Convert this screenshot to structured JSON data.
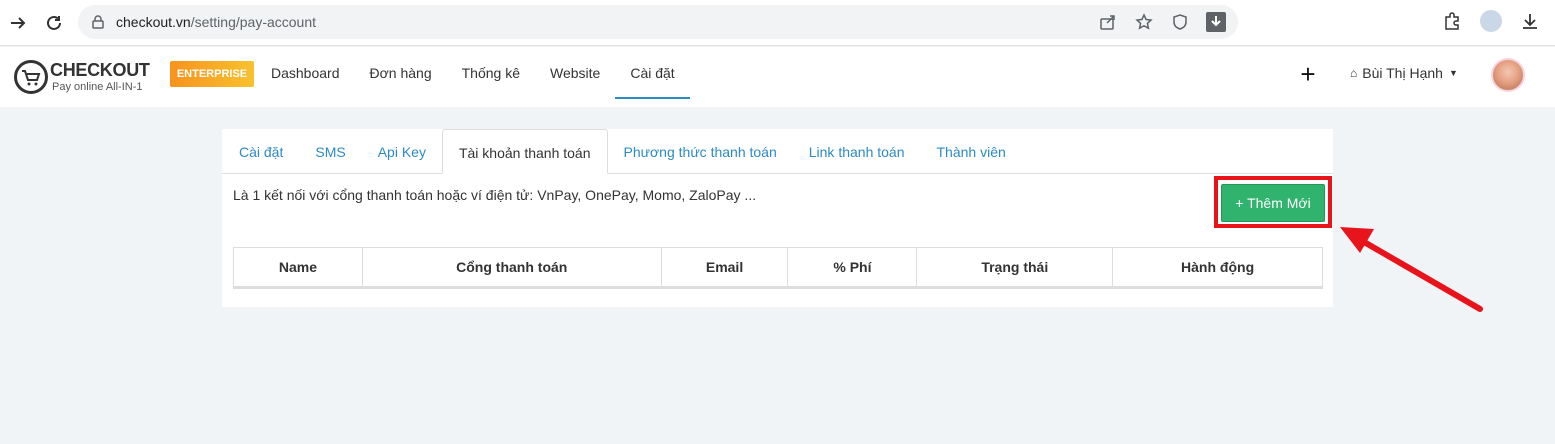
{
  "browser": {
    "url_host": "checkout.vn",
    "url_path": "/setting/pay-account"
  },
  "header": {
    "logo_title": "CHECKOUT",
    "logo_subtitle": "Pay online All-IN-1",
    "badge": "ENTERPRISE",
    "nav": [
      {
        "label": "Dashboard"
      },
      {
        "label": "Đơn hàng"
      },
      {
        "label": "Thống kê"
      },
      {
        "label": "Website"
      },
      {
        "label": "Cài đặt"
      }
    ],
    "user_name": "Bùi Thị Hạnh"
  },
  "tabs": [
    {
      "label": "Cài đặt"
    },
    {
      "label": "SMS"
    },
    {
      "label": "Api Key"
    },
    {
      "label": "Tài khoản thanh toán"
    },
    {
      "label": "Phương thức thanh toán"
    },
    {
      "label": "Link thanh toán"
    },
    {
      "label": "Thành viên"
    }
  ],
  "content": {
    "description": "Là 1 kết nối với cổng thanh toán hoặc ví điện tử: VnPay, OnePay, Momo, ZaloPay ...",
    "add_button": "+ Thêm Mới",
    "columns": [
      "Name",
      "Cổng thanh toán",
      "Email",
      "% Phí",
      "Trạng thái",
      "Hành động"
    ]
  },
  "colors": {
    "accent": "#2b8bc6",
    "button": "#2fb36d",
    "highlight": "#e8141b"
  }
}
